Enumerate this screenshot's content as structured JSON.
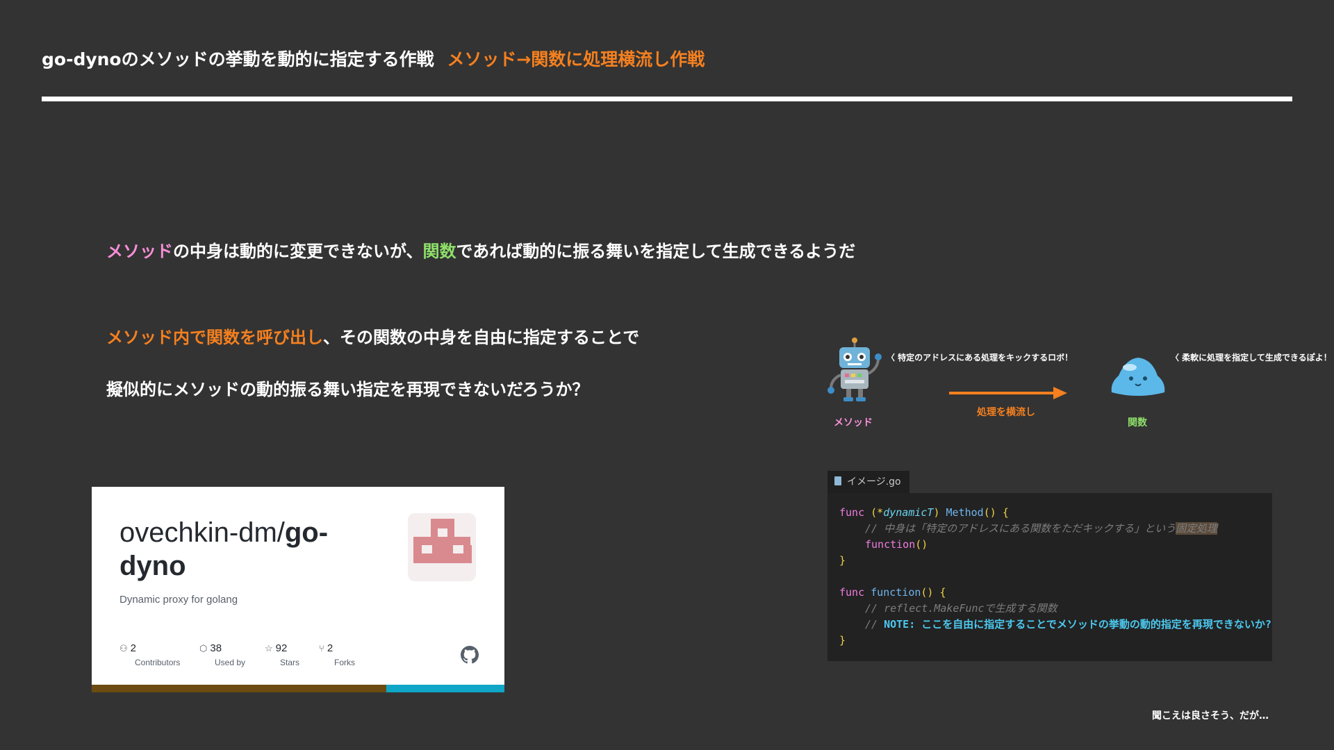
{
  "slide": {
    "title_main": "go-dynoのメソッドの挙動を動的に指定する作戦",
    "title_accent": "メソッド→関数に処理横流し作戦",
    "line1_method": "メソッド",
    "line1_mid": "の中身は動的に変更できないが、",
    "line1_func": "関数",
    "line1_end": "であれば動的に振る舞いを指定して生成できるようだ",
    "line2_accent": "メソッド内で関数を呼び出し",
    "line2_end": "、その関数の中身を自由に指定することで",
    "line3": "擬似的にメソッドの動的振る舞い指定を再現できないだろうか？",
    "footer": "聞こえは良さそう、だが…"
  },
  "repo_card": {
    "owner": "ovechkin-dm/",
    "repo": "go-dyno",
    "description": "Dynamic proxy for golang",
    "stats": [
      {
        "icon": "people-icon",
        "value": "2",
        "label": "Contributors"
      },
      {
        "icon": "package-icon",
        "value": "38",
        "label": "Used by"
      },
      {
        "icon": "star-icon",
        "value": "92",
        "label": "Stars"
      },
      {
        "icon": "fork-icon",
        "value": "2",
        "label": "Forks"
      }
    ],
    "language_colors": [
      "#6b4b12",
      "#0fa6c8"
    ]
  },
  "diagram": {
    "robot_note": "〈 特定のアドレスにある処理をキックするロボ！",
    "slime_note": "〈 柔軟に処理を指定して生成できるぽよ！",
    "method_caption": "メソッド",
    "func_caption": "関数",
    "arrow_caption": "処理を横流し"
  },
  "editor": {
    "tab_label": "イメージ.go",
    "lines": {
      "l1_func": "func",
      "l1_open": "(*",
      "l1_type": "dynamicT",
      "l1_close": ")",
      "l1_name": "Method",
      "l1_paren": "()",
      "l1_brace": "{",
      "l2_comment": "// 中身は「特定のアドレスにある関数をただキックする」という",
      "l2_highlight": "固定処理",
      "l3_call": "function",
      "l3_paren": "()",
      "l4_brace": "}",
      "l6_func": "func",
      "l6_name": "function",
      "l6_paren": "()",
      "l6_brace": "{",
      "l7_comment": "// reflect.MakeFuncで生成する関数",
      "l8_slashes": "//",
      "l8_note": "NOTE: ここを自由に指定することでメソッドの挙動の動的指定を再現できないか?",
      "l9_brace": "}"
    }
  },
  "colors": {
    "background": "#333333",
    "accent_orange": "#f5801f",
    "method_pink": "#f78fd8",
    "function_green": "#8ee06a"
  }
}
